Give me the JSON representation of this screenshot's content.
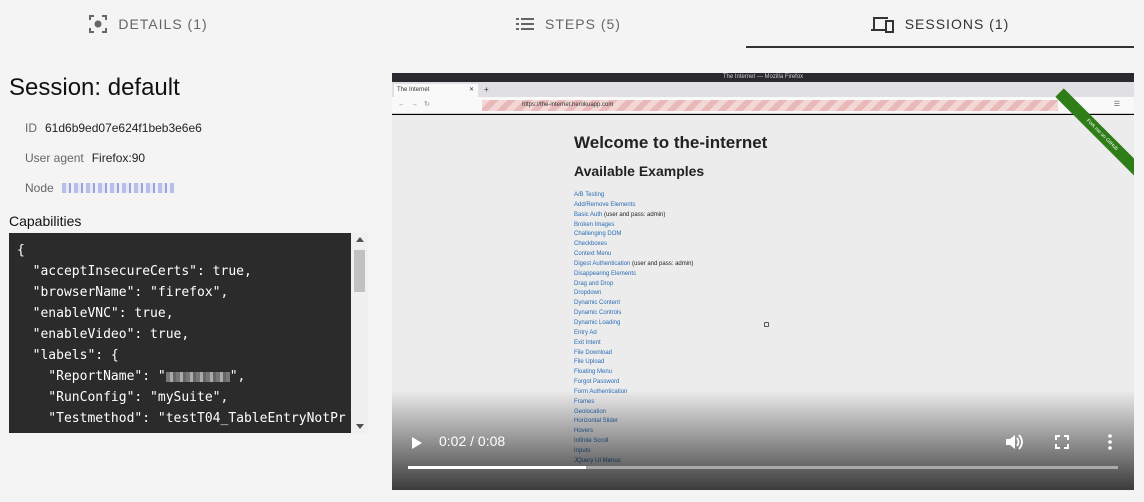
{
  "tabs": [
    {
      "label": "DETAILS (1)",
      "icon": "details-icon"
    },
    {
      "label": "STEPS (5)",
      "icon": "steps-list-icon"
    },
    {
      "label": "SESSIONS (1)",
      "icon": "sessions-devices-icon",
      "active": true
    }
  ],
  "session": {
    "title": "Session: default",
    "id_label": "ID",
    "id_value": "61d6b9ed07e624f1beb3e6e6",
    "agent_label": "User agent",
    "agent_value": "Firefox:90",
    "node_label": "Node"
  },
  "capabilities": {
    "title": "Capabilities",
    "lines": [
      "{",
      "  \"acceptInsecureCerts\": true,",
      "  \"browserName\": \"firefox\",",
      "  \"enableVNC\": true,",
      "  \"enableVideo\": true,",
      "  \"labels\": {",
      "    \"ReportName\": \"",
      "    \"RunConfig\": \"mySuite\",",
      "    \"Testmethod\": \"testT04_TableEntryNotPr"
    ],
    "report_name_suffix": "\","
  },
  "video": {
    "window_title": "The Internet — Mozilla Firefox",
    "browser_tab": "The Internet",
    "url": "https://the-internet.herokuapp.com",
    "heading": "Welcome to the-internet",
    "subheading": "Available Examples",
    "ribbon": "Fork me on GitHub",
    "links": [
      {
        "text": "A/B Testing"
      },
      {
        "text": "Add/Remove Elements"
      },
      {
        "text": "Basic Auth",
        "note": " (user and pass: admin)"
      },
      {
        "text": "Broken Images"
      },
      {
        "text": "Challenging DOM"
      },
      {
        "text": "Checkboxes"
      },
      {
        "text": "Context Menu"
      },
      {
        "text": "Digest Authentication",
        "note": " (user and pass: admin)"
      },
      {
        "text": "Disappearing Elements"
      },
      {
        "text": "Drag and Drop"
      },
      {
        "text": "Dropdown"
      },
      {
        "text": "Dynamic Content"
      },
      {
        "text": "Dynamic Controls"
      },
      {
        "text": "Dynamic Loading"
      },
      {
        "text": "Entry Ad"
      },
      {
        "text": "Exit Intent"
      },
      {
        "text": "File Download"
      },
      {
        "text": "File Upload"
      },
      {
        "text": "Floating Menu"
      },
      {
        "text": "Forgot Password"
      },
      {
        "text": "Form Authentication"
      },
      {
        "text": "Frames"
      },
      {
        "text": "Geolocation"
      },
      {
        "text": "Horizontal Slider"
      },
      {
        "text": "Hovers"
      },
      {
        "text": "Infinite Scroll"
      },
      {
        "text": "Inputs"
      },
      {
        "text": "JQuery UI Menus"
      }
    ],
    "time": "0:02 / 0:08",
    "progress": 0.25
  }
}
